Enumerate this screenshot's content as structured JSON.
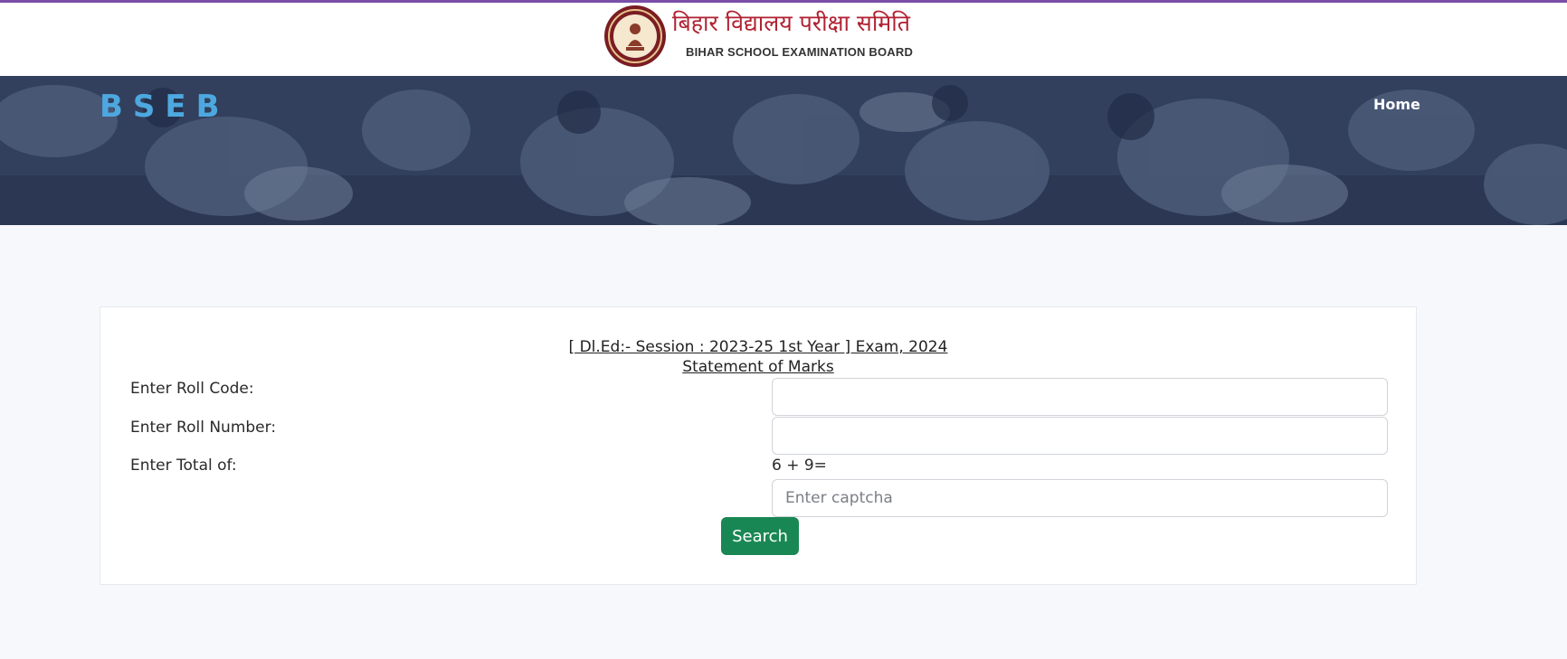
{
  "header": {
    "logo_hindi": "बिहार विद्यालय परीक्षा समिति",
    "logo_english": "BIHAR SCHOOL EXAMINATION BOARD"
  },
  "navbar": {
    "brand": "BSEB",
    "home_label": "Home"
  },
  "form": {
    "title_line1": "[ Dl.Ed:- Session : 2023-25 1st Year ] Exam, 2024",
    "title_line2": "Statement of Marks",
    "roll_code_label": "Enter Roll Code:",
    "roll_code_value": "",
    "roll_number_label": "Enter Roll Number:",
    "roll_number_value": "",
    "total_label": "Enter Total of:",
    "captcha_question": "6 + 9=",
    "captcha_placeholder": "Enter captcha",
    "search_label": "Search"
  },
  "colors": {
    "accent_top_line": "#7a4fa8",
    "brand_blue": "#4ea8e0",
    "search_green": "#198754",
    "logo_red": "#b02232"
  }
}
